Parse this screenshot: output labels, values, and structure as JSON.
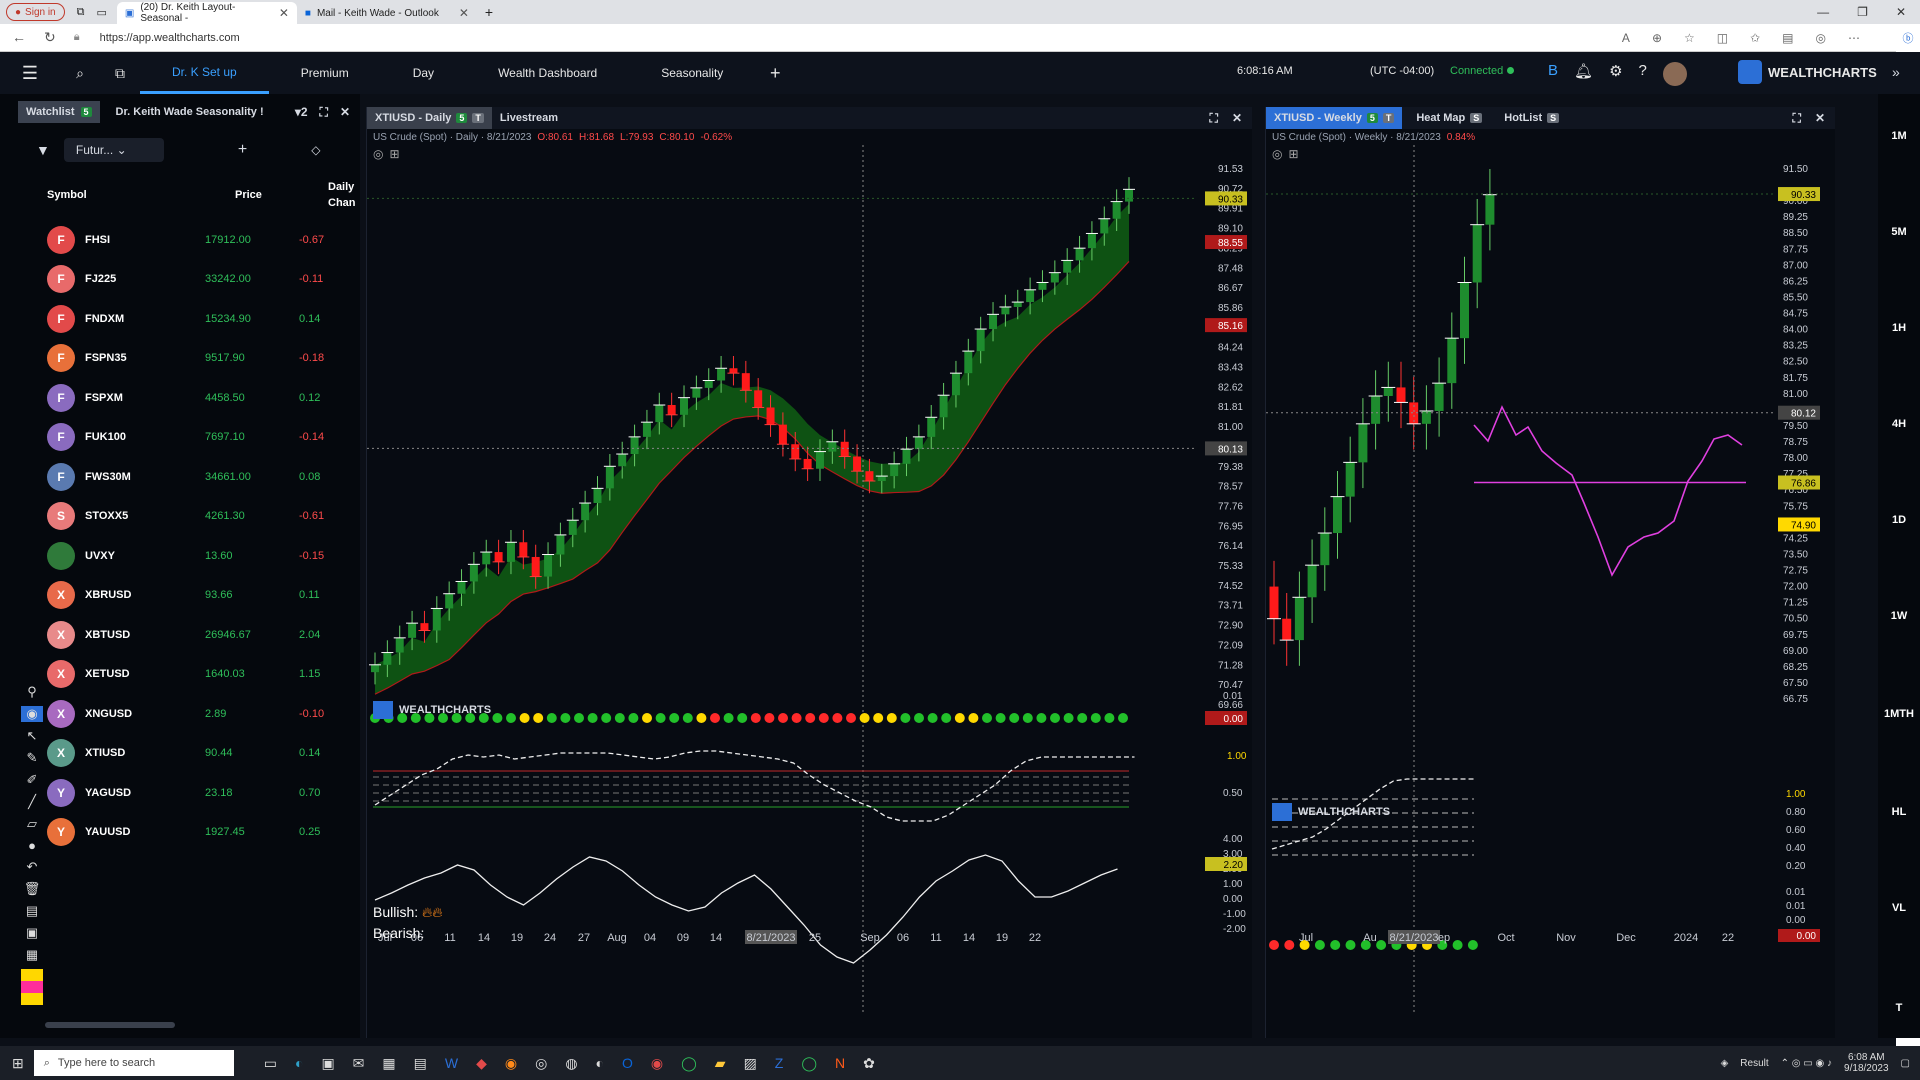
{
  "browser": {
    "signin": "Sign in",
    "tabs": [
      {
        "title": "(20) Dr. Keith Layout-Seasonal -"
      },
      {
        "title": "Mail - Keith Wade - Outlook"
      }
    ],
    "url": "https://app.wealthcharts.com"
  },
  "app": {
    "tabs": [
      "Dr. K Set up",
      "Premium",
      "Day",
      "Wealth Dashboard",
      "Seasonality"
    ],
    "active_tab": "Dr. K Set up",
    "clock": "6:08:16 AM",
    "timezone": "(UTC -04:00)",
    "connection": "Connected",
    "brand": "WEALTHCHARTS"
  },
  "watchlist": {
    "tab1": "Watchlist",
    "tab1_count": "5",
    "tab2": "Dr. Keith Wade Seasonality !",
    "tab2_count": "2",
    "filter": "Futur...",
    "headers": {
      "symbol": "Symbol",
      "price": "Price",
      "change": "Daily Chan"
    },
    "rows": [
      {
        "letter": "F",
        "symbol": "FHSI",
        "price": "17912.00",
        "change": "-0.67",
        "color": "#e24a4a"
      },
      {
        "letter": "F",
        "symbol": "FJ225",
        "price": "33242.00",
        "change": "-0.11",
        "color": "#e86a6a"
      },
      {
        "letter": "F",
        "symbol": "FNDXM",
        "price": "15234.90",
        "change": "0.14",
        "color": "#e24a4a"
      },
      {
        "letter": "F",
        "symbol": "FSPN35",
        "price": "9517.90",
        "change": "-0.18",
        "color": "#e8703a"
      },
      {
        "letter": "F",
        "symbol": "FSPXM",
        "price": "4458.50",
        "change": "0.12",
        "color": "#8a6bbf"
      },
      {
        "letter": "F",
        "symbol": "FUK100",
        "price": "7697.10",
        "change": "-0.14",
        "color": "#8a6bbf"
      },
      {
        "letter": "F",
        "symbol": "FWS30M",
        "price": "34661.00",
        "change": "0.08",
        "color": "#5a7ab0"
      },
      {
        "letter": "S",
        "symbol": "STOXX5",
        "price": "4261.30",
        "change": "-0.61",
        "color": "#e87a7a"
      },
      {
        "letter": "",
        "symbol": "UVXY",
        "price": "13.60",
        "change": "-0.15",
        "color": "#2f7a3a"
      },
      {
        "letter": "X",
        "symbol": "XBRUSD",
        "price": "93.66",
        "change": "0.11",
        "color": "#e86a4a"
      },
      {
        "letter": "X",
        "symbol": "XBTUSD",
        "price": "26946.67",
        "change": "2.04",
        "color": "#e88a8a"
      },
      {
        "letter": "X",
        "symbol": "XETUSD",
        "price": "1640.03",
        "change": "1.15",
        "color": "#e86a6a"
      },
      {
        "letter": "X",
        "symbol": "XNGUSD",
        "price": "2.89",
        "change": "-0.10",
        "color": "#a86ac0"
      },
      {
        "letter": "X",
        "symbol": "XTIUSD",
        "price": "90.44",
        "change": "0.14",
        "color": "#5a9a8a"
      },
      {
        "letter": "Y",
        "symbol": "YAGUSD",
        "price": "23.18",
        "change": "0.70",
        "color": "#8a6bbf"
      },
      {
        "letter": "Y",
        "symbol": "YAUUSD",
        "price": "1927.45",
        "change": "0.25",
        "color": "#e8703a"
      }
    ]
  },
  "chart_daily": {
    "tab": "XTIUSD - Daily",
    "tab_badge1": "5",
    "tab_badge2": "T",
    "tab2": "Livestream",
    "info": "US Crude (Spot) · Daily · 8/21/2023",
    "info_o": "O:80.61",
    "info_h": "H:81.68",
    "info_l": "L:79.93",
    "info_c": "C:80.10",
    "info_chg": "-0.62%",
    "brand": "WEALTHCHARTS",
    "price_ticks": [
      "91.53",
      "90.72",
      "89.91",
      "89.10",
      "88.29",
      "87.48",
      "86.67",
      "85.86",
      "85.05",
      "84.24",
      "83.43",
      "82.62",
      "81.81",
      "81.00",
      "80.19",
      "79.38",
      "78.57",
      "77.76",
      "76.95",
      "76.14",
      "75.33",
      "74.52",
      "73.71",
      "72.90",
      "72.09",
      "71.28",
      "70.47",
      "69.66"
    ],
    "tag_last": "90.33",
    "tag_high": "88.55",
    "tag_mid": "85.16",
    "tag_cross": "80.13",
    "ind1_ticks": [
      "0.01"
    ],
    "ind1_value": "0.00",
    "ind2_ticks": [
      "1.00",
      "0.50"
    ],
    "ind2_value": "1.00",
    "ind3_bull": "Bullish:",
    "ind3_bear": "Bearish:",
    "ind3_ticks": [
      "4.00",
      "3.00",
      "2.00",
      "1.00",
      "0.00",
      "-1.00",
      "-2.00"
    ],
    "ind3_value": "2.20",
    "x_ticks": [
      "Jul",
      "06",
      "11",
      "14",
      "19",
      "24",
      "27",
      "Aug",
      "04",
      "09",
      "14",
      "8/21/2023",
      "25",
      "Sep",
      "06",
      "11",
      "14",
      "19",
      "22"
    ]
  },
  "chart_weekly": {
    "tab": "XTIUSD - Weekly",
    "tab_badge1": "5",
    "tab_badge2": "T",
    "tab2": "Heat Map",
    "tab2_badge": "S",
    "tab3": "HotList",
    "tab3_badge": "S",
    "info": "US Crude (Spot) · Weekly · 8/21/2023",
    "info_chg": "0.84%",
    "brand": "WEALTHCHARTS",
    "price_ticks": [
      "91.50",
      "90.00",
      "89.25",
      "88.50",
      "87.75",
      "87.00",
      "86.25",
      "85.50",
      "84.75",
      "84.00",
      "83.25",
      "82.50",
      "81.75",
      "81.00",
      "80.25",
      "79.50",
      "78.75",
      "78.00",
      "77.25",
      "76.50",
      "75.75",
      "75.00",
      "74.25",
      "73.50",
      "72.75",
      "72.00",
      "71.25",
      "70.50",
      "69.75",
      "69.00",
      "68.25",
      "67.50",
      "66.75"
    ],
    "tag_last": "90.33",
    "tag_cross": "80.12",
    "tag_mid": "76.86",
    "tag_low": "74.90",
    "ind2_ticks": [
      "1.00",
      "0.80",
      "0.60",
      "0.40",
      "0.20"
    ],
    "ind1_ticks": [
      "0.01",
      "0.01",
      "0.00"
    ],
    "ind1_value": "0.00",
    "x_ticks": [
      "Jul",
      "Au",
      "8/21/2023",
      "ep",
      "Oct",
      "Nov",
      "Dec",
      "2024",
      "22"
    ]
  },
  "timeframes": [
    "1M",
    "5M",
    "1H",
    "4H",
    "1D",
    "1W",
    "1MTH",
    "HL",
    "VL",
    "T"
  ],
  "taskbar": {
    "search": "Type here to search",
    "result": "Result",
    "time": "6:08 AM",
    "date": "9/18/2023"
  },
  "colors": {
    "bull": "#1e8c2e",
    "bear": "#ff1a1a",
    "accent": "#3aa0ff",
    "seasonal": "#e040e0",
    "cloud": "#0f5a14"
  }
}
